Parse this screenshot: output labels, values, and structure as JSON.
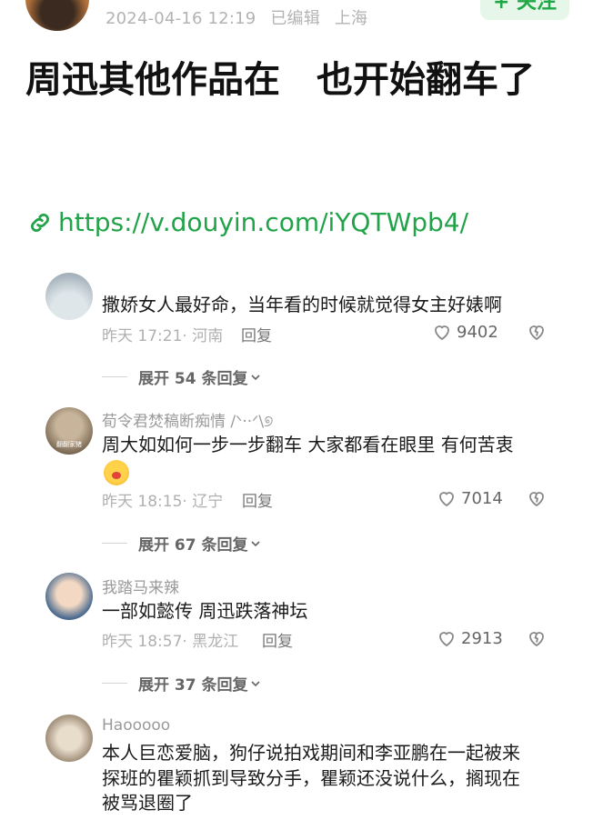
{
  "post": {
    "date": "2024-04-16 12:19",
    "edited": "已编辑",
    "location": "上海",
    "follow_label": "+ 关注",
    "title": "周迅其他作品在　也开始翻车了",
    "link": "https://v.douyin.com/iYQTWpb4/"
  },
  "comments": [
    {
      "name": "",
      "text": "撒娇女人最好命，当年看的时候就觉得女主好婊啊",
      "time": "昨天 17:21",
      "region": "河南",
      "reply_label": "回复",
      "likes": "9402",
      "expand": "展开 54 条回复"
    },
    {
      "name": "荀令君焚稿断痴情 /ᐠ··ᐟ\\୭",
      "text": "周大如如何一步一步翻车 大家都看在眼里 有何苦衷",
      "avatar_text": "翻翻家猪",
      "time": "昨天 18:15",
      "region": "辽宁",
      "reply_label": "回复",
      "likes": "7014",
      "expand": "展开 67 条回复"
    },
    {
      "name": "我踏马来辣",
      "text": "一部如懿传 周迅跌落神坛",
      "time": "昨天 18:57",
      "region": "黑龙江",
      "reply_label": "回复",
      "likes": "2913",
      "expand": "展开 37 条回复"
    },
    {
      "name": "Haooooo",
      "text_lines": [
        "本人巨恋爱脑，狗仔说拍戏期间和李亚鹏在一起被来",
        "探班的瞿颖抓到导致分手，瞿颖还没说什么，搁现在",
        "被骂退圈了"
      ]
    }
  ],
  "colors": {
    "accent": "#21a349",
    "follow_bg": "#e6f7ea"
  },
  "icons": [
    "link-icon",
    "heart-icon",
    "broken-heart-icon",
    "chevron-down-icon"
  ]
}
